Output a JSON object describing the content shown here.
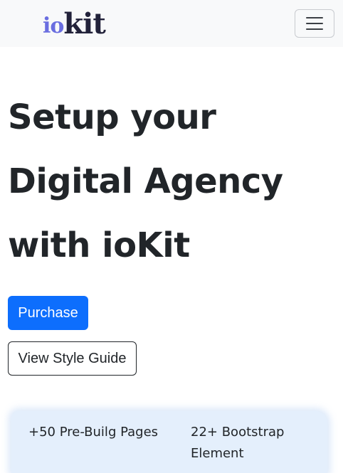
{
  "navbar": {
    "brand": {
      "part1": "io",
      "part2": "kit"
    },
    "toggle_icon": "hamburger-menu-icon"
  },
  "hero": {
    "title_lines": [
      "Setup your",
      "Digital Agency",
      "with ioKit"
    ],
    "purchase_label": "Purchase",
    "style_guide_label": "View Style Guide"
  },
  "features": [
    {
      "text": "+50 Pre-Builg Pages"
    },
    {
      "text": "22+ Bootstrap Element"
    }
  ],
  "colors": {
    "primary": "#0d6efd",
    "navbar_bg": "#f8f9fa",
    "brand_io": "#6a6ee0",
    "brand_kit": "#22223a",
    "text": "#212529",
    "panel_bg": "#e4effc"
  }
}
